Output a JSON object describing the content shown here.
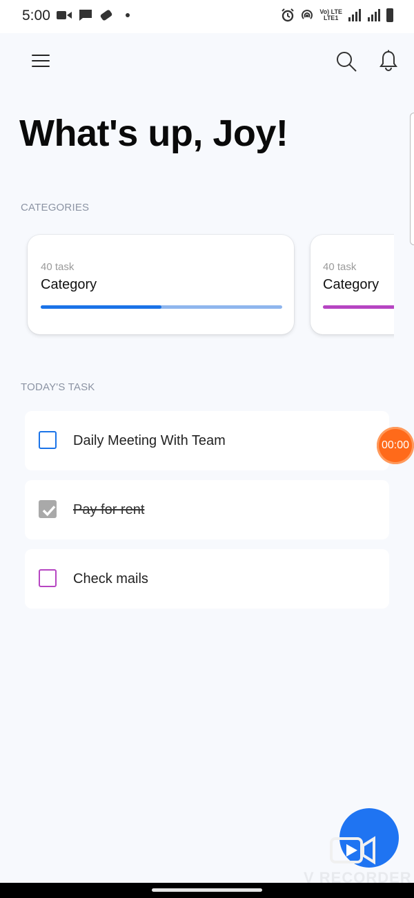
{
  "status_bar": {
    "time": "5:00",
    "icons": [
      "video-icon",
      "message-icon",
      "game-icon",
      "dot-icon",
      "alarm-icon",
      "hotspot-icon",
      "volte-icon",
      "lte-icon",
      "signal-icon",
      "battery-icon"
    ],
    "network_top": "Vo) LTE",
    "network_bottom": "LTE1"
  },
  "header": {
    "icons": [
      "menu-icon",
      "search-icon",
      "bell-icon"
    ]
  },
  "greeting": "What's up, Joy!",
  "categories": {
    "label": "CATEGORIES",
    "items": [
      {
        "count": "40 task",
        "title": "Category",
        "progress": 0.5,
        "color": "#1a73e8",
        "track_color": "#8fb6ee"
      },
      {
        "count": "40 task",
        "title": "Category",
        "progress": 0.58,
        "color": "#b645c2",
        "track_color": "#dcaee3"
      }
    ]
  },
  "todays_task": {
    "label": "TODAY'S TASK",
    "items": [
      {
        "label": "Daily Meeting With Team",
        "checked": false,
        "color": "#1a73e8"
      },
      {
        "label": "Pay for rent",
        "checked": true,
        "color": "#a9a9a9"
      },
      {
        "label": "Check mails",
        "checked": false,
        "color": "#b645c2"
      }
    ]
  },
  "timer_badge": "00:00",
  "fab": {
    "icon": "add-icon",
    "color": "#1f74f2"
  },
  "watermark": "V RECORDER"
}
